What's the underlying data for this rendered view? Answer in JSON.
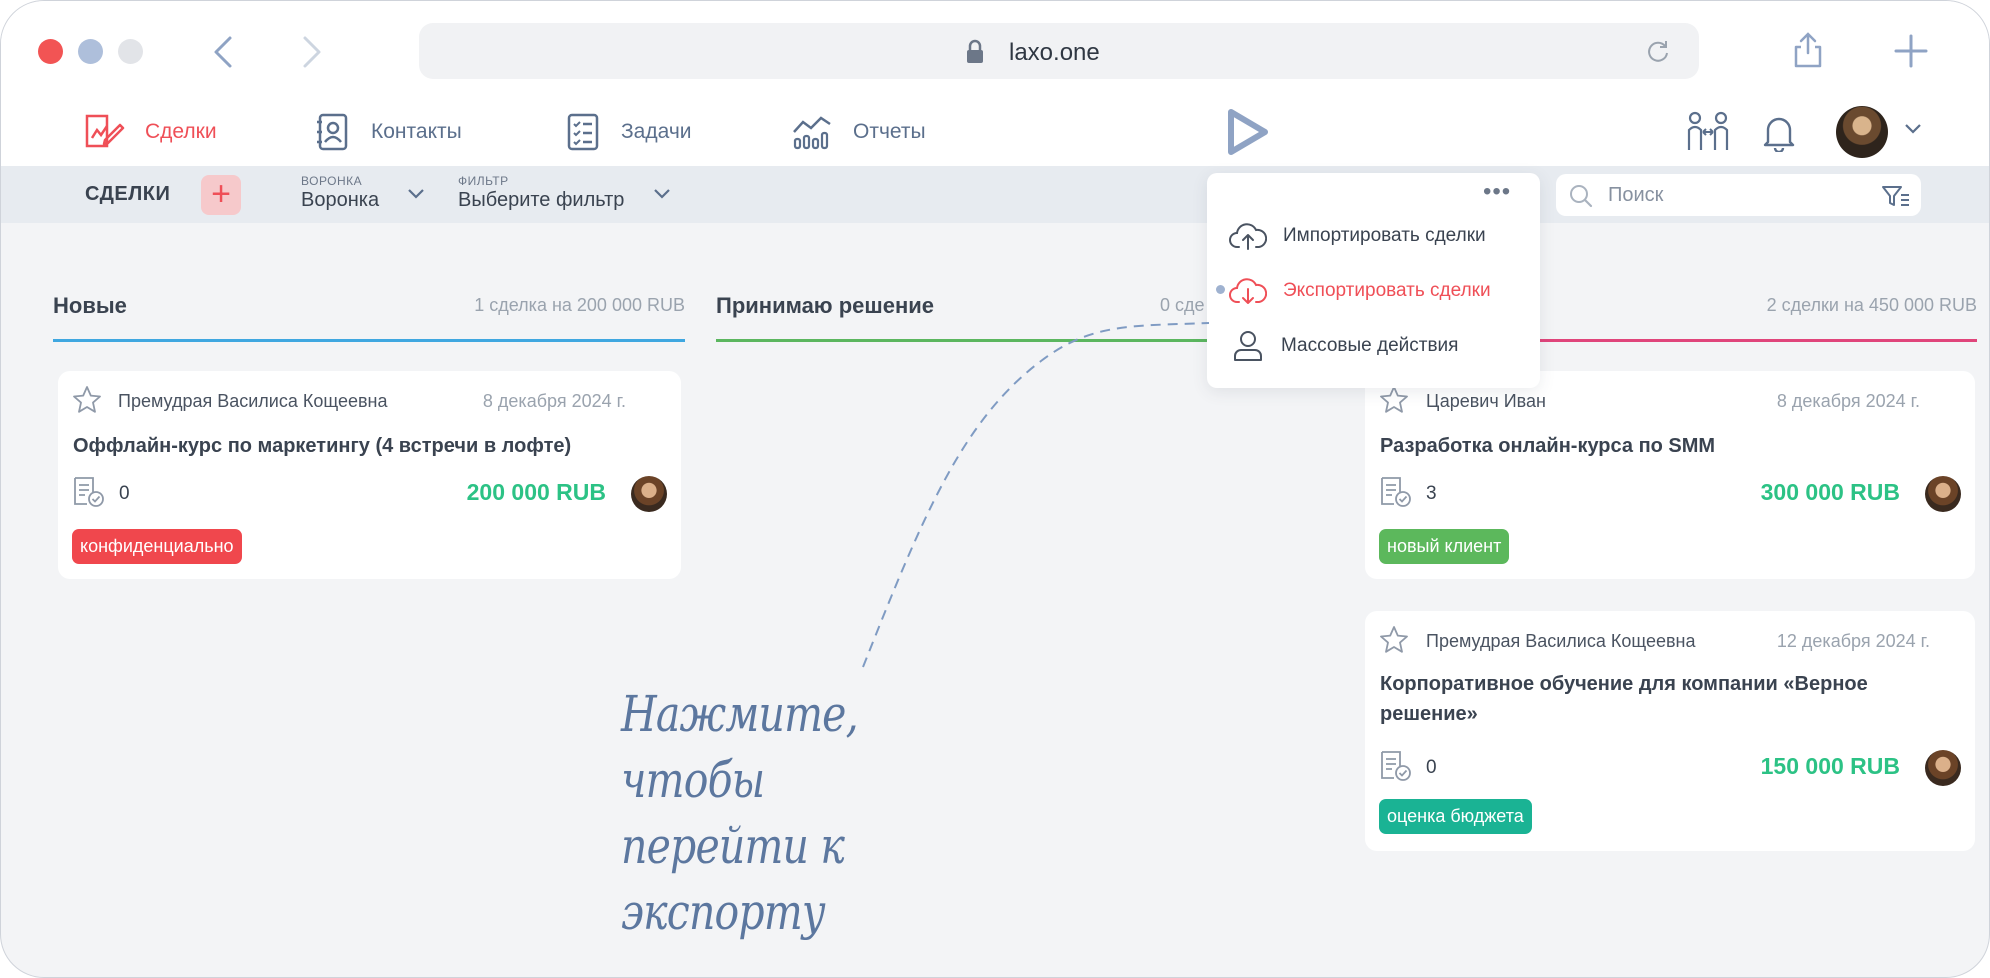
{
  "browser": {
    "url": "laxo.one"
  },
  "nav": {
    "deals": "Сделки",
    "contacts": "Контакты",
    "tasks": "Задачи",
    "reports": "Отчеты"
  },
  "toolbar": {
    "title": "СДЕЛКИ",
    "add": "+",
    "funnel_label": "ВОРОНКА",
    "funnel_value": "Воронка",
    "filter_label": "ФИЛЬТР",
    "filter_value": "Выберите фильтр",
    "search_placeholder": "Поиск"
  },
  "columns": [
    {
      "name": "Новые",
      "summary": "1 сделка на 200 000 RUB",
      "color": "#3fa7e0",
      "cards": [
        {
          "person": "Премудрая Василиса Кощеевна",
          "date": "8 декабря 2024 г.",
          "title": "Оффлайн-курс по маркетингу (4 встречи в лофте)",
          "count": "0",
          "amount": "200 000 RUB",
          "tag": "конфиденциально",
          "tag_color": "#f0474d"
        }
      ]
    },
    {
      "name": "Принимаю решение",
      "summary": "0 сде",
      "color": "#5bb65f",
      "cards": []
    },
    {
      "name": "",
      "summary": "2 сделки на 450 000 RUB",
      "color": "#e0457b",
      "cards": [
        {
          "person": "Царевич Иван",
          "date": "8 декабря 2024 г.",
          "title": "Разработка онлайн-курса по SMM",
          "count": "3",
          "amount": "300 000 RUB",
          "tag": "новый клиент",
          "tag_color": "#5cb85c"
        },
        {
          "person": "Премудрая Василиса Кощеевна",
          "date": "12 декабря 2024 г.",
          "title": "Корпоративное обучение для компании «Верное решение»",
          "count": "0",
          "amount": "150 000 RUB",
          "tag": "оценка бюджета",
          "tag_color": "#1ab394"
        }
      ]
    }
  ],
  "menu": {
    "more": "•••",
    "items": [
      {
        "label": "Импортировать сделки",
        "icon": "cloud-upload-icon"
      },
      {
        "label": "Экспортировать сделки",
        "icon": "cloud-download-icon",
        "highlighted": true
      },
      {
        "label": "Массовые действия",
        "icon": "user-icon"
      }
    ]
  },
  "hint": {
    "line1": "Нажмите, чтобы",
    "line2": "перейти к экспорту"
  },
  "colors": {
    "accent": "#ef4f57",
    "money": "#2cc285",
    "nav": "#5b6f8c"
  }
}
